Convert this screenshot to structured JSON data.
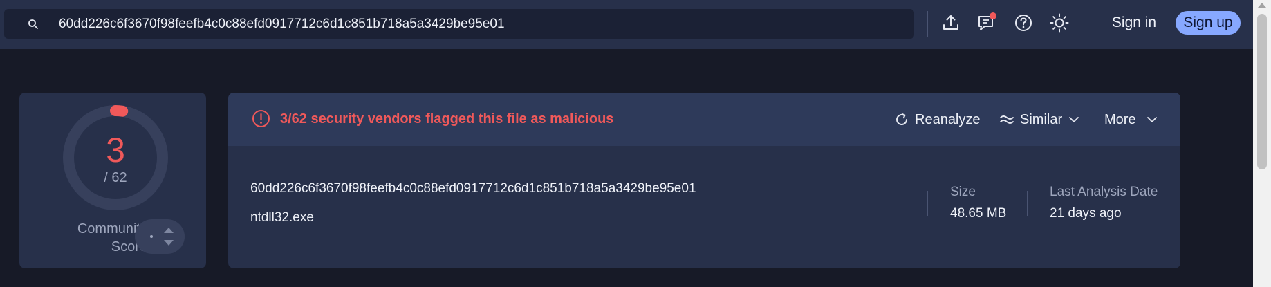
{
  "search": {
    "query": "60dd226c6f3670f98feefb4c0c88efd0917712c6d1c851b718a5a3429be95e01"
  },
  "topbar": {
    "icons": [
      "upload-icon",
      "chat-icon",
      "help-icon",
      "theme-icon"
    ],
    "sign_in_label": "Sign in",
    "sign_up_label": "Sign up"
  },
  "score": {
    "detections": "3",
    "total": "/ 62",
    "community_label": "Community Score",
    "detection_ratio": 0.048
  },
  "alert": {
    "text": "3/62 security vendors flagged this file as malicious",
    "color": "#f0595a"
  },
  "actions": {
    "reanalyze_label": "Reanalyze",
    "similar_label": "Similar",
    "more_label": "More"
  },
  "file": {
    "hash": "60dd226c6f3670f98feefb4c0c88efd0917712c6d1c851b718a5a3429be95e01",
    "name": "ntdll32.exe",
    "size_label": "Size",
    "size_value": "48.65 MB",
    "date_label": "Last Analysis Date",
    "date_value": "21 days ago"
  },
  "colors": {
    "accent": "#87a8ff",
    "danger": "#f0595a",
    "panel": "#27304a",
    "background": "#171a27"
  }
}
